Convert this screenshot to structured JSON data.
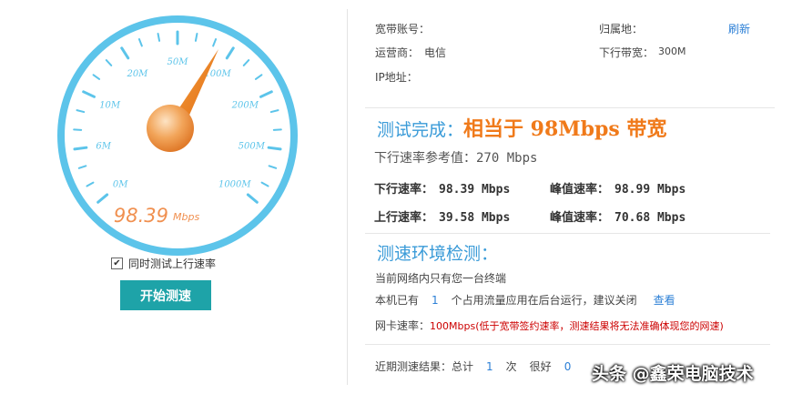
{
  "gauge": {
    "scale_labels": [
      "0M",
      "6M",
      "10M",
      "20M",
      "50M",
      "100M",
      "200M",
      "500M",
      "1000M"
    ],
    "reading_value": "98.39",
    "reading_unit": "Mbps",
    "colors": {
      "ring": "#5cc4ea",
      "needle": "#f08a1e",
      "hub": "#f2a55a",
      "reading": "#f09050"
    }
  },
  "controls": {
    "upload_checkbox_label": "同时测试上行速率",
    "upload_checked": true,
    "check_mark": "✔",
    "start_button_label": "开始测速",
    "accent": "#1ea3a8"
  },
  "account": {
    "account_label": "宽带账号：",
    "account_value": "",
    "region_label": "归属地：",
    "refresh_label": "刷新",
    "carrier_label": "运营商：",
    "carrier_value": "电信",
    "down_bw_label": "下行带宽：",
    "down_bw_value": "300M",
    "ip_label": "IP地址：",
    "ip_value": ""
  },
  "result": {
    "title_prefix": "测试完成：",
    "title_highlight": "相当于 98Mbps 带宽",
    "ref_label": "下行速率参考值：",
    "ref_value": "270 Mbps",
    "down_label": "下行速率：",
    "down_value": "98.39 Mbps",
    "peak_down_label": "峰值速率：",
    "peak_down_value": "98.99 Mbps",
    "up_label": "上行速率：",
    "up_value": "39.58 Mbps",
    "peak_up_label": "峰值速率：",
    "peak_up_value": "70.68 Mbps"
  },
  "environment": {
    "title": "测速环境检测：",
    "line1": "当前网络内只有您一台终端",
    "line2_prefix": "本机已有",
    "line2_count": "1",
    "line2_suffix": "个占用流量应用在后台运行，建议关闭",
    "line2_link": "查看",
    "nic_label": "网卡速率：",
    "nic_value": "100Mbps(低于宽带签约速率，测速结果将无法准确体现您的网速)"
  },
  "recent": {
    "label": "近期测速结果：总计",
    "count": "1",
    "unit": "次",
    "good_label": "很好",
    "good_count": "0"
  },
  "watermark": "头条 @鑫荣电脑技术"
}
